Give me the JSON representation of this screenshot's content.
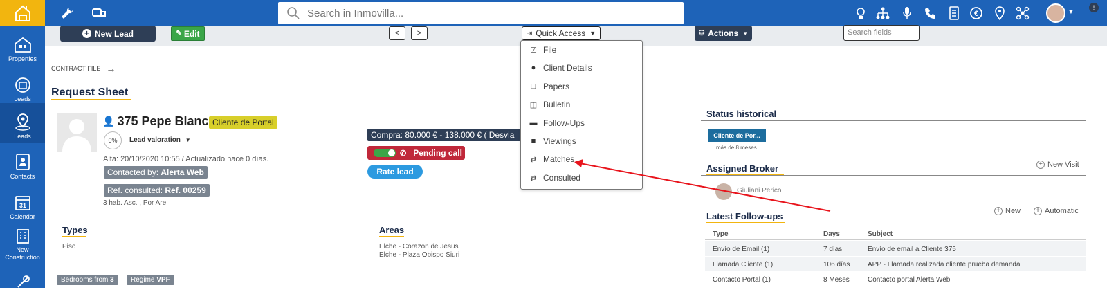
{
  "colors": {
    "brand": "#1e63b8",
    "accent": "#f2b50f",
    "dark": "#2e3e56",
    "green": "#3aa648",
    "red": "#c0283a",
    "blue_btn": "#2c9ae0",
    "status": "#1d6d9e",
    "portal_tag": "#d8cf2a"
  },
  "search": {
    "placeholder": "Search in Inmovilla..."
  },
  "sidebar": {
    "items": [
      {
        "label": "Properties",
        "icon": "building-icon"
      },
      {
        "label": "Leads",
        "icon": "leads-icon"
      },
      {
        "label": "Leads",
        "icon": "map-pin-user-icon"
      },
      {
        "label": "Contacts",
        "icon": "contacts-icon"
      },
      {
        "label": "Calendar",
        "icon": "calendar-icon",
        "badge": "31"
      },
      {
        "label": "New Construction",
        "icon": "construction-icon"
      }
    ]
  },
  "toolbar": {
    "new_lead": "New Lead",
    "edit": "Edit",
    "prev": "<",
    "next": ">",
    "quick_access": "Quick Access",
    "actions": "Actions",
    "search_fields_placeholder": "Search fields"
  },
  "quick_access_menu": [
    {
      "label": "File",
      "icon": "check-square-icon"
    },
    {
      "label": "Client Details",
      "icon": "user-icon"
    },
    {
      "label": "Papers",
      "icon": "folder-icon"
    },
    {
      "label": "Bulletin",
      "icon": "bulletin-icon"
    },
    {
      "label": "Follow-Ups",
      "icon": "minus-box-icon"
    },
    {
      "label": "Viewings",
      "icon": "briefcase-icon"
    },
    {
      "label": "Matches",
      "icon": "shuffle-icon"
    },
    {
      "label": "Consulted",
      "icon": "shuffle-icon"
    }
  ],
  "breadcrumb": {
    "label": "CONTRACT FILE"
  },
  "page_title": "Request Sheet",
  "lead": {
    "name": "375 Pepe Blanco",
    "portal_tag": "Cliente de Portal",
    "valoration_pct": "0%",
    "valoration_label": "Lead valoration",
    "dates": "Alta: 20/10/2020 10:55 / Actualizado hace 0 días.",
    "contacted_by_label": "Contacted by:",
    "contacted_by_value": "Alerta Web",
    "ref_label": "Ref. consulted:",
    "ref_value": "Ref. 00259",
    "summary": "3 hab. Asc. , Por Are",
    "purchase": "Compra: 80.000 € - 138.000 € ( Desvia",
    "pending_call": "Pending call",
    "rate_lead": "Rate lead"
  },
  "types": {
    "title": "Types",
    "value": "Piso"
  },
  "areas": {
    "title": "Areas",
    "values": [
      "Elche - Corazon de Jesus",
      "Elche - Plaza Obispo Siuri"
    ]
  },
  "tags_bottom": {
    "bedrooms_label": "Bedrooms from",
    "bedrooms_value": "3",
    "regime_label": "Regime",
    "regime_value": "VPF"
  },
  "status_historical": {
    "title": "Status historical",
    "status": "Cliente de Por...",
    "since": "más de 8 meses"
  },
  "assigned_broker": {
    "title": "Assigned Broker",
    "new_visit": "New Visit",
    "broker_name": "Giuliani Perico"
  },
  "latest_followups": {
    "title": "Latest Follow-ups",
    "new": "New",
    "automatic": "Automatic",
    "headers": [
      "Type",
      "Days",
      "Subject"
    ],
    "rows": [
      [
        "Envío de Email (1)",
        "7 días",
        "Envío de email a Cliente 375"
      ],
      [
        "Llamada Cliente (1)",
        "106 días",
        "APP - Llamada realizada cliente prueba demanda"
      ],
      [
        "Contacto Portal (1)",
        "8 Meses",
        "Contacto portal Alerta Web"
      ]
    ]
  },
  "top_icons": [
    "lightbulb-icon",
    "org-chart-icon",
    "microphone-icon",
    "phone-icon",
    "document-icon",
    "euro-icon",
    "location-pin-icon",
    "network-icon"
  ]
}
